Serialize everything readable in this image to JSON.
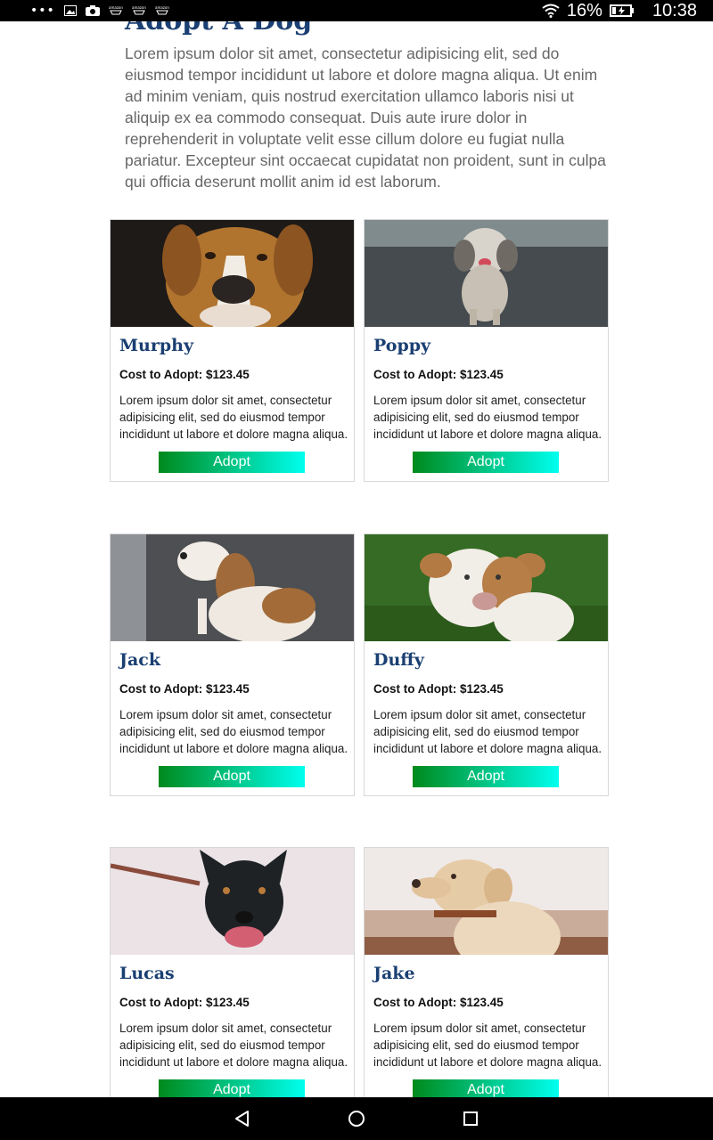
{
  "status_bar": {
    "overflow": "•••",
    "battery": "16%",
    "time": "10:38",
    "icons": [
      "gallery-icon",
      "camera-icon",
      "amazon-cart-icon",
      "amazon-cart-icon",
      "amazon-cart-icon",
      "wifi-icon",
      "battery-charging-icon"
    ]
  },
  "page": {
    "title": "Adopt A Dog",
    "intro": "Lorem ipsum dolor sit amet, consectetur adipisicing elit, sed do eiusmod tempor incididunt ut labore et dolore magna aliqua. Ut enim ad minim veniam, quis nostrud exercitation ullamco laboris nisi ut aliquip ex ea commodo consequat. Duis aute irure dolor in reprehenderit in voluptate velit esse cillum dolore eu fugiat nulla pariatur. Excepteur sint occaecat cupidatat non proident, sunt in culpa qui officia deserunt mollit anim id est laborum."
  },
  "dogs": [
    {
      "name": "Murphy",
      "cost": "Cost to Adopt: $123.45",
      "description": "Lorem ipsum dolor sit amet, consectetur adipisicing elit, sed do eiusmod tempor incididunt ut labore et dolore magna aliqua.",
      "button": "Adopt",
      "photo": "brown-boxer-mix"
    },
    {
      "name": "Poppy",
      "cost": "Cost to Adopt: $123.45",
      "description": "Lorem ipsum dolor sit amet, consectetur adipisicing elit, sed do eiusmod tempor incididunt ut labore et dolore magna aliqua.",
      "button": "Adopt",
      "photo": "grey-shih-tzu"
    },
    {
      "name": "Jack",
      "cost": "Cost to Adopt: $123.45",
      "description": "Lorem ipsum dolor sit amet, consectetur adipisicing elit, sed do eiusmod tempor incididunt ut labore et dolore magna aliqua.",
      "button": "Adopt",
      "photo": "beagle"
    },
    {
      "name": "Duffy",
      "cost": "Cost to Adopt: $123.45",
      "description": "Lorem ipsum dolor sit amet, consectetur adipisicing elit, sed do eiusmod tempor incididunt ut labore et dolore magna aliqua.",
      "button": "Adopt",
      "photo": "white-pitbull"
    },
    {
      "name": "Lucas",
      "cost": "Cost to Adopt: $123.45",
      "description": "Lorem ipsum dolor sit amet, consectetur adipisicing elit, sed do eiusmod tempor incididunt ut labore et dolore magna aliqua.",
      "button": "Adopt",
      "photo": "black-dog"
    },
    {
      "name": "Jake",
      "cost": "Cost to Adopt: $123.45",
      "description": "Lorem ipsum dolor sit amet, consectetur adipisicing elit, sed do eiusmod tempor incididunt ut labore et dolore magna aliqua.",
      "button": "Adopt",
      "photo": "yellow-labrador"
    }
  ],
  "colors": {
    "title": "#1a3f72",
    "intro_text": "#666666",
    "button_gradient_start": "#008a1c",
    "button_gradient_end": "#00ffee",
    "card_border": "#d8d8d8"
  },
  "nav_bar": {
    "icons": [
      "back-icon",
      "home-icon",
      "recents-icon"
    ]
  }
}
